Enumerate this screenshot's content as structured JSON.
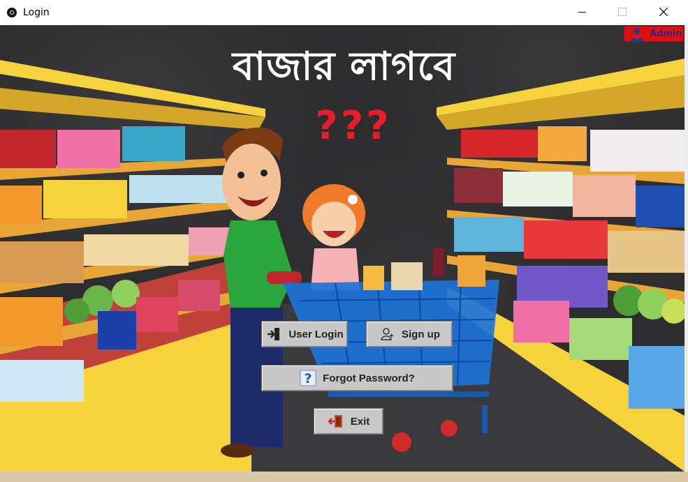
{
  "window": {
    "title": "Login"
  },
  "header": {
    "admin_label": "Admin",
    "heading": "বাজার লাগবে",
    "question": "???"
  },
  "buttons": {
    "user_login": "User Login",
    "sign_up": "Sign up",
    "forgot_password": "Forgot Password?",
    "exit": "Exit"
  },
  "colors": {
    "admin_bg": "#e01010",
    "question_red": "#e61e2a",
    "button_gray": "#c8c8c8",
    "cart_blue": "#1e73d8",
    "shelf_yellow": "#f6d33c"
  },
  "icons": [
    "app-icon",
    "minimize-icon",
    "maximize-icon",
    "close-icon",
    "admin-user-icon",
    "login-icon",
    "user-icon",
    "help-icon",
    "exit-door-icon"
  ]
}
